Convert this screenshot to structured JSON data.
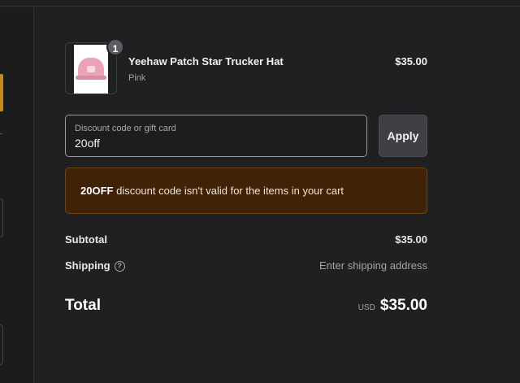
{
  "cart_item": {
    "quantity": "1",
    "title": "Yeehaw Patch Star Trucker Hat",
    "variant": "Pink",
    "price": "$35.00",
    "image_icon": "pink-trucker-hat-image"
  },
  "discount": {
    "label": "Discount code or gift card",
    "value": "20off",
    "apply_label": "Apply"
  },
  "error": {
    "code": "20OFF",
    "message": " discount code isn't valid for the items in your cart",
    "color": "#402306"
  },
  "summary": {
    "subtotal_label": "Subtotal",
    "subtotal_value": "$35.00",
    "shipping_label": "Shipping",
    "shipping_help_icon": "question-circle-icon",
    "shipping_value": "Enter shipping address",
    "total_label": "Total",
    "total_currency": "USD",
    "total_value": "$35.00"
  },
  "colors": {
    "background": "#1f2022",
    "accent": "#c48a1a"
  }
}
